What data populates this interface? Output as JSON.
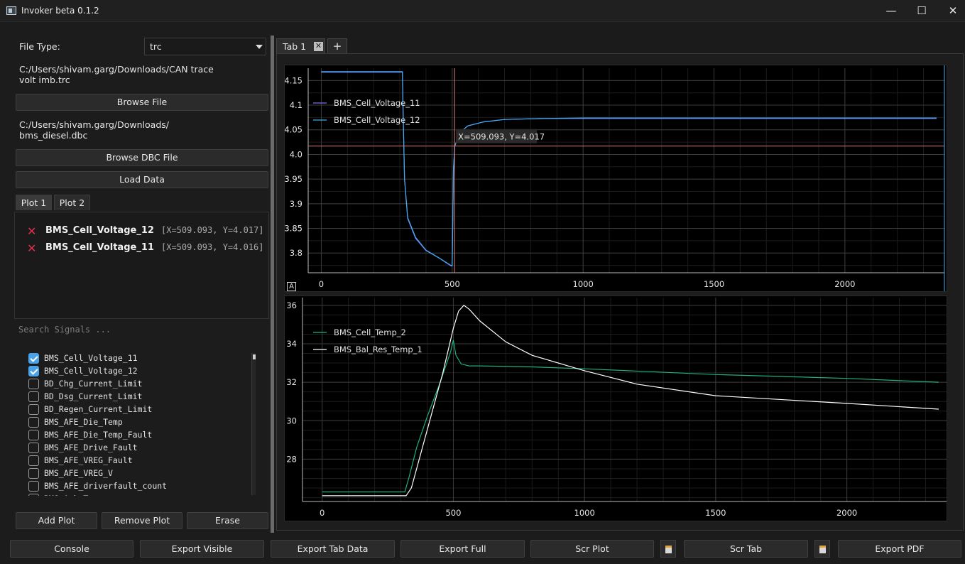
{
  "window": {
    "title": "Invoker beta 0.1.2",
    "minimize": "—",
    "maximize": "☐",
    "close": "✕"
  },
  "left": {
    "file_type_label": "File Type:",
    "file_type_value": "trc",
    "trace_path_line1": "C:/Users/shivam.garg/Downloads/CAN trace",
    "trace_path_line2": "volt imb.trc",
    "browse_file": "Browse File",
    "dbc_path_line1": "C:/Users/shivam.garg/Downloads/",
    "dbc_path_line2": "bms_diesel.dbc",
    "browse_dbc": "Browse DBC File",
    "load_data": "Load Data",
    "plot_tabs": [
      "Plot 1",
      "Plot 2"
    ],
    "legend_items": [
      {
        "name": "BMS_Cell_Voltage_12",
        "coord": "[X=509.093, Y=4.017]"
      },
      {
        "name": "BMS_Cell_Voltage_11",
        "coord": "[X=509.093, Y=4.016]"
      }
    ],
    "search_placeholder": "Search Signals ...",
    "signals": [
      {
        "name": "BMS_Cell_Voltage_11",
        "checked": true
      },
      {
        "name": "BMS_Cell_Voltage_12",
        "checked": true
      },
      {
        "name": "BD_Chg_Current_Limit",
        "checked": false
      },
      {
        "name": "BD_Dsg_Current_Limit",
        "checked": false
      },
      {
        "name": "BD_Regen_Current_Limit",
        "checked": false
      },
      {
        "name": "BMS_AFE_Die_Temp",
        "checked": false
      },
      {
        "name": "BMS_AFE_Die_Temp_Fault",
        "checked": false
      },
      {
        "name": "BMS_AFE_Drive_Fault",
        "checked": false
      },
      {
        "name": "BMS_AFE_VREG_Fault",
        "checked": false
      },
      {
        "name": "BMS_AFE_VREG_V",
        "checked": false
      },
      {
        "name": "BMS_AFE_driverfault_count",
        "checked": false
      },
      {
        "name": "BMS_Amb_Temp",
        "checked": false
      }
    ],
    "add_plot": "Add Plot",
    "remove_plot": "Remove Plot",
    "erase": "Erase"
  },
  "tabs": {
    "items": [
      "Tab 1"
    ],
    "close_glyph": "✕",
    "add": "+"
  },
  "plots": {
    "auto_range_label": "A",
    "cursor_readout": "X=509.093, Y=4.017"
  },
  "chart_data": [
    {
      "type": "line",
      "xlim": [
        -50,
        2380
      ],
      "ylim": [
        3.76,
        4.175
      ],
      "x_ticks": [
        0,
        500,
        1000,
        1500,
        2000
      ],
      "y_ticks": [
        3.8,
        3.85,
        3.9,
        3.95,
        4.0,
        4.05,
        4.1,
        4.15
      ],
      "y_tick_labels": [
        "3.8",
        "3.85",
        "3.9",
        "3.95",
        "4.0",
        "4.05",
        "4.1",
        "4.15"
      ],
      "grid": true,
      "legend_position": "top-left",
      "cursor": {
        "x": 509.093,
        "y": 4.017
      },
      "series": [
        {
          "name": "BMS_Cell_Voltage_11",
          "color": "#7a6cf0",
          "x": [
            0,
            310,
            312,
            318,
            330,
            360,
            400,
            450,
            495,
            500,
            505,
            510,
            530,
            560,
            620,
            700,
            850,
            1000,
            1500,
            2000,
            2350
          ],
          "y": [
            4.167,
            4.167,
            4.1,
            3.95,
            3.87,
            3.83,
            3.805,
            3.79,
            3.774,
            3.774,
            3.97,
            4.017,
            4.045,
            4.058,
            4.066,
            4.071,
            4.073,
            4.073,
            4.073,
            4.073,
            4.073
          ]
        },
        {
          "name": "BMS_Cell_Voltage_12",
          "color": "#3eaef0",
          "x": [
            0,
            310,
            312,
            318,
            330,
            360,
            400,
            450,
            495,
            500,
            505,
            510,
            530,
            560,
            620,
            700,
            850,
            1000,
            1500,
            2000,
            2350
          ],
          "y": [
            4.168,
            4.168,
            4.1,
            3.95,
            3.872,
            3.832,
            3.806,
            3.79,
            3.775,
            3.775,
            3.97,
            4.017,
            4.045,
            4.058,
            4.066,
            4.071,
            4.073,
            4.074,
            4.074,
            4.074,
            4.074
          ]
        }
      ]
    },
    {
      "type": "line",
      "xlim": [
        -75,
        2380
      ],
      "ylim": [
        25.8,
        36.4
      ],
      "x_ticks": [
        0,
        500,
        1000,
        1500,
        2000
      ],
      "y_ticks": [
        28,
        30,
        32,
        34,
        36
      ],
      "grid": true,
      "legend_position": "top-left",
      "series": [
        {
          "name": "BMS_Cell_Temp_2",
          "color": "#1fb082",
          "x": [
            0,
            315,
            330,
            360,
            400,
            450,
            490,
            500,
            510,
            530,
            560,
            600,
            800,
            1000,
            1500,
            2000,
            2350
          ],
          "y": [
            26.3,
            26.3,
            27.0,
            28.6,
            30.2,
            32.0,
            33.6,
            34.2,
            33.4,
            32.95,
            32.85,
            32.85,
            32.8,
            32.7,
            32.4,
            32.2,
            32.0
          ]
        },
        {
          "name": "BMS_Bal_Res_Temp_1",
          "color": "#ffffff",
          "x": [
            0,
            320,
            340,
            380,
            420,
            460,
            500,
            520,
            540,
            560,
            600,
            700,
            800,
            1000,
            1200,
            1500,
            2000,
            2350
          ],
          "y": [
            26.1,
            26.1,
            26.5,
            28.5,
            30.5,
            32.5,
            34.8,
            35.7,
            36.0,
            35.8,
            35.2,
            34.1,
            33.4,
            32.6,
            31.9,
            31.3,
            30.9,
            30.6
          ]
        }
      ]
    }
  ],
  "bottom": {
    "console": "Console",
    "export_visible": "Export Visible",
    "export_tab_data": "Export Tab Data",
    "export_full": "Export Full",
    "scr_plot": "Scr Plot",
    "scr_tab": "Scr Tab",
    "export_pdf": "Export PDF"
  }
}
